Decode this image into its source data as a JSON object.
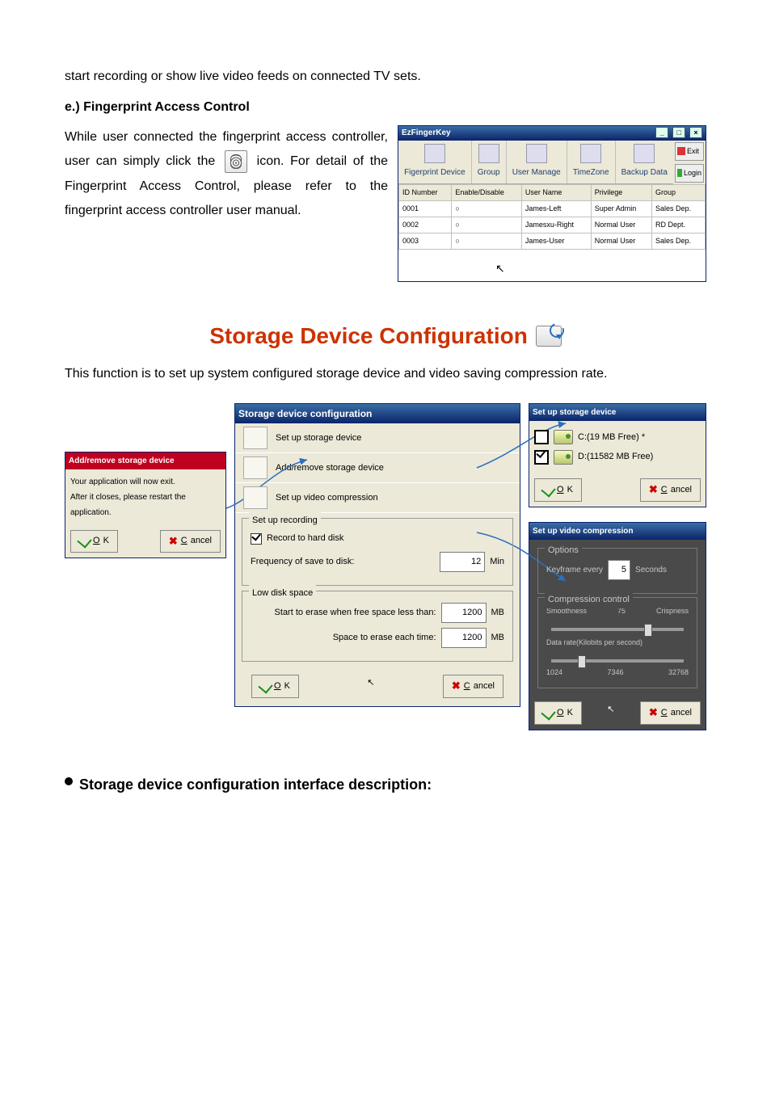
{
  "intro_para": "start recording or show live video feeds on connected TV sets.",
  "section_e_title": "e.) Fingerprint Access Control",
  "fp_para_before_icon": "While user connected the fingerprint access controller, user can simply click the ",
  "fp_para_after_icon": " icon. For detail of the Fingerprint Access Control, please refer to the fingerprint access controller user manual.",
  "ez": {
    "title": "EzFingerKey",
    "toolbar": [
      {
        "label": "Figerprint Device",
        "name": "fingerprint-device"
      },
      {
        "label": "Group",
        "name": "group"
      },
      {
        "label": "User Manage",
        "name": "user-manage"
      },
      {
        "label": "TimeZone",
        "name": "timezone"
      },
      {
        "label": "Backup Data",
        "name": "backup-data"
      }
    ],
    "side": {
      "exit": "Exit",
      "login": "Login"
    },
    "headers": [
      "ID Number",
      "Enable/Disable",
      "User Name",
      "Privilege",
      "Group"
    ],
    "rows": [
      {
        "id": "0001",
        "ed": "○",
        "name": "James-Left",
        "priv": "Super Admin",
        "group": "Sales Dep."
      },
      {
        "id": "0002",
        "ed": "○",
        "name": "Jamesxu-Right",
        "priv": "Normal User",
        "group": "RD Dept."
      },
      {
        "id": "0003",
        "ed": "○",
        "name": "James-User",
        "priv": "Normal User",
        "group": "Sales Dep."
      }
    ]
  },
  "heading": "Storage Device Configuration",
  "heading_para": "This function is to set up system configured storage device and video saving compression rate.",
  "addremove": {
    "title": "Add/remove storage device",
    "msg1": "Your application will now exit.",
    "msg2": "After it closes, please restart the application.",
    "ok": "OK",
    "cancel": "Cancel"
  },
  "maincfg": {
    "title": "Storage device configuration",
    "item1": "Set up storage device",
    "item2": "Add/remove storage device",
    "item3": "Set up video compression",
    "grp1": {
      "legend": "Set up recording",
      "record": "Record to hard disk",
      "freq_label": "Frequency of save to disk:",
      "freq_value": "12",
      "freq_unit": "Min"
    },
    "grp2": {
      "legend": "Low disk space",
      "l1": "Start to erase when free space less than:",
      "v1": "1200",
      "u1": "MB",
      "l2": "Space to erase each time:",
      "v2": "1200",
      "u2": "MB"
    },
    "ok": "OK",
    "cancel": "Cancel"
  },
  "storagedlg": {
    "title": "Set up storage device",
    "d1": "C:(19 MB Free) *",
    "d2": "D:(11582 MB Free)",
    "ok": "OK",
    "cancel": "Cancel"
  },
  "compdlg": {
    "title": "Set up video compression",
    "grp_options": "Options",
    "keyframe_label": "Keyframe every",
    "keyframe_value": "5",
    "keyframe_unit": "Seconds",
    "grp_cc": "Compression control",
    "smooth": "Smoothness",
    "value_75": "75",
    "crisp": "Crispness",
    "datarate": "Data rate(Kilobits per second)",
    "r_low": "1024",
    "r_mid": "7346",
    "r_high": "32768",
    "ok": "OK",
    "cancel": "Cancel"
  },
  "bullet": "Storage device configuration interface description:"
}
